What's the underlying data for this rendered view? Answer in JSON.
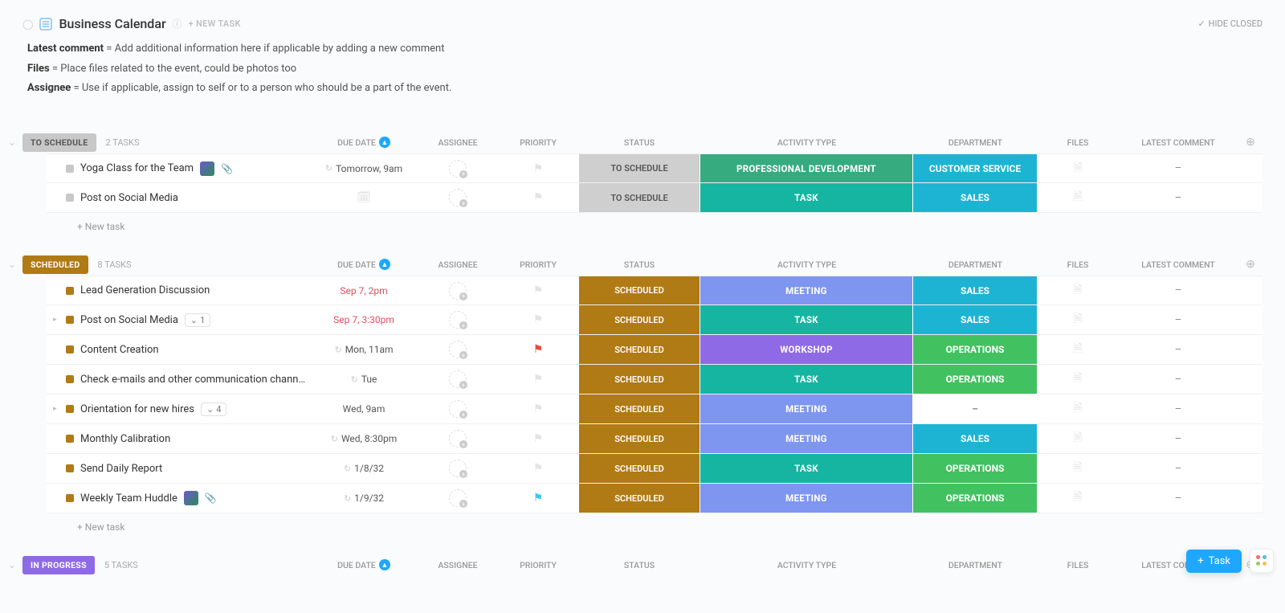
{
  "header": {
    "title": "Business Calendar",
    "new_task": "+ NEW TASK",
    "hide_closed": "HIDE CLOSED"
  },
  "descriptions": [
    {
      "label": "Latest comment",
      "text": " = Add additional information here if applicable by adding a new comment"
    },
    {
      "label": "Files",
      "text": " = Place files related to the event, could be photos too"
    },
    {
      "label": "Assignee",
      "text": " = Use if applicable, assign to self or to a person who should be a part of the event."
    }
  ],
  "columns": {
    "due": "DUE DATE",
    "assignee": "ASSIGNEE",
    "priority": "PRIORITY",
    "status": "STATUS",
    "activity": "ACTIVITY TYPE",
    "department": "DEPARTMENT",
    "files": "FILES",
    "comment": "LATEST COMMENT"
  },
  "groups": [
    {
      "name": "TO SCHEDULE",
      "pill_class": "pill-schedule",
      "count": "2 TASKS",
      "square": "#c8c8c8",
      "rows": [
        {
          "name": "Yoga Class for the Team",
          "has_avatar": true,
          "has_clip": true,
          "due": "Tomorrow, 9am",
          "due_red": false,
          "recur": true,
          "cal": false,
          "status": "TO SCHEDULE",
          "status_class": "",
          "activity": "PROFESSIONAL DEVELOPMENT",
          "activity_bg": "bg-green",
          "department": "CUSTOMER SERVICE",
          "dept_bg": "bg-cyan",
          "comment": "–"
        },
        {
          "name": "Post on Social Media",
          "due": "",
          "recur": false,
          "cal": true,
          "status": "TO SCHEDULE",
          "status_class": "",
          "activity": "TASK",
          "activity_bg": "bg-teal",
          "department": "SALES",
          "dept_bg": "bg-cyan",
          "comment": "–"
        }
      ]
    },
    {
      "name": "SCHEDULED",
      "pill_class": "pill-scheduled",
      "count": "8 TASKS",
      "square": "#b07a15",
      "rows": [
        {
          "name": "Lead Generation Discussion",
          "due": "Sep 7, 2pm",
          "due_red": true,
          "status": "SCHEDULED",
          "status_class": "scheduled",
          "activity": "MEETING",
          "activity_bg": "bg-blue",
          "department": "SALES",
          "dept_bg": "bg-cyan",
          "comment": "–"
        },
        {
          "name": "Post on Social Media",
          "sub_badge": "1",
          "has_caret": true,
          "due": "Sep 7, 3:30pm",
          "due_red": true,
          "status": "SCHEDULED",
          "status_class": "scheduled",
          "activity": "TASK",
          "activity_bg": "bg-teal",
          "department": "SALES",
          "dept_bg": "bg-cyan",
          "comment": "–"
        },
        {
          "name": "Content Creation",
          "due": "Mon, 11am",
          "recur": true,
          "status": "SCHEDULED",
          "status_class": "scheduled",
          "flag": "red",
          "activity": "WORKSHOP",
          "activity_bg": "bg-purple",
          "department": "OPERATIONS",
          "dept_bg": "bg-greenb",
          "comment": "–"
        },
        {
          "name": "Check e-mails and other communication channels",
          "due": "Tue",
          "recur": true,
          "status": "SCHEDULED",
          "status_class": "scheduled",
          "activity": "TASK",
          "activity_bg": "bg-teal",
          "department": "OPERATIONS",
          "dept_bg": "bg-greenb",
          "comment": "–"
        },
        {
          "name": "Orientation for new hires",
          "sub_badge": "4",
          "has_caret": true,
          "due": "Wed, 9am",
          "status": "SCHEDULED",
          "status_class": "scheduled",
          "activity": "MEETING",
          "activity_bg": "bg-blue",
          "department": "–",
          "dept_bg": "bg-none",
          "comment": "–"
        },
        {
          "name": "Monthly Calibration",
          "due": "Wed, 8:30pm",
          "recur": true,
          "status": "SCHEDULED",
          "status_class": "scheduled",
          "activity": "MEETING",
          "activity_bg": "bg-blue",
          "department": "SALES",
          "dept_bg": "bg-cyan",
          "comment": "–"
        },
        {
          "name": "Send Daily Report",
          "due": "1/8/32",
          "recur": true,
          "status": "SCHEDULED",
          "status_class": "scheduled",
          "activity": "TASK",
          "activity_bg": "bg-teal",
          "department": "OPERATIONS",
          "dept_bg": "bg-greenb",
          "comment": "–"
        },
        {
          "name": "Weekly Team Huddle",
          "has_avatar": true,
          "has_clip": true,
          "due": "1/9/32",
          "recur": true,
          "flag": "cyan",
          "status": "SCHEDULED",
          "status_class": "scheduled",
          "activity": "MEETING",
          "activity_bg": "bg-blue",
          "department": "OPERATIONS",
          "dept_bg": "bg-greenb",
          "comment": "–"
        }
      ]
    },
    {
      "name": "IN PROGRESS",
      "pill_class": "pill-inprogress",
      "count": "5 TASKS",
      "square": "#8e6ae6",
      "header_only": true
    }
  ],
  "new_task_row": "+ New task",
  "fab": {
    "label": "Task"
  }
}
